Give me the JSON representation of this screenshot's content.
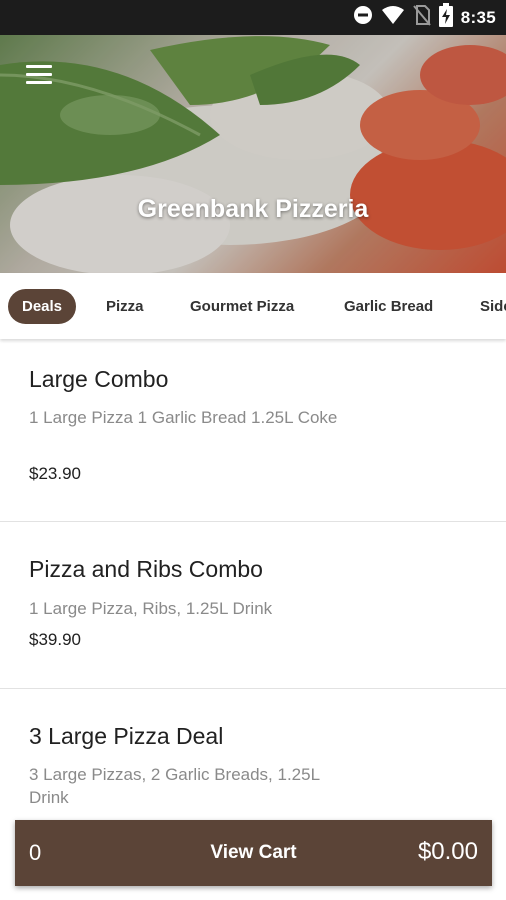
{
  "status_bar": {
    "time": "8:35",
    "icons": [
      "do-not-disturb-icon",
      "wifi-icon",
      "no-sim-icon",
      "battery-charging-icon"
    ]
  },
  "header": {
    "title": "Greenbank Pizzeria",
    "menu_icon": "hamburger-menu-icon"
  },
  "tabs": [
    {
      "label": "Deals",
      "active": true
    },
    {
      "label": "Pizza",
      "active": false
    },
    {
      "label": "Gourmet Pizza",
      "active": false
    },
    {
      "label": "Garlic Bread",
      "active": false
    },
    {
      "label": "Side",
      "active": false
    }
  ],
  "items": [
    {
      "name": "Large Combo",
      "description": "1 Large Pizza 1 Garlic Bread 1.25L Coke",
      "price": "$23.90"
    },
    {
      "name": "Pizza and Ribs Combo",
      "description": "1 Large Pizza, Ribs, 1.25L Drink",
      "price": "$39.90"
    },
    {
      "name": "3 Large Pizza Deal",
      "description": "3 Large Pizzas, 2 Garlic Breads, 1.25L Drink",
      "price": ""
    }
  ],
  "cart": {
    "count": "0",
    "label": "View Cart",
    "total": "$0.00"
  },
  "colors": {
    "accent": "#5b4437",
    "status_bar": "#1c1c1c"
  }
}
